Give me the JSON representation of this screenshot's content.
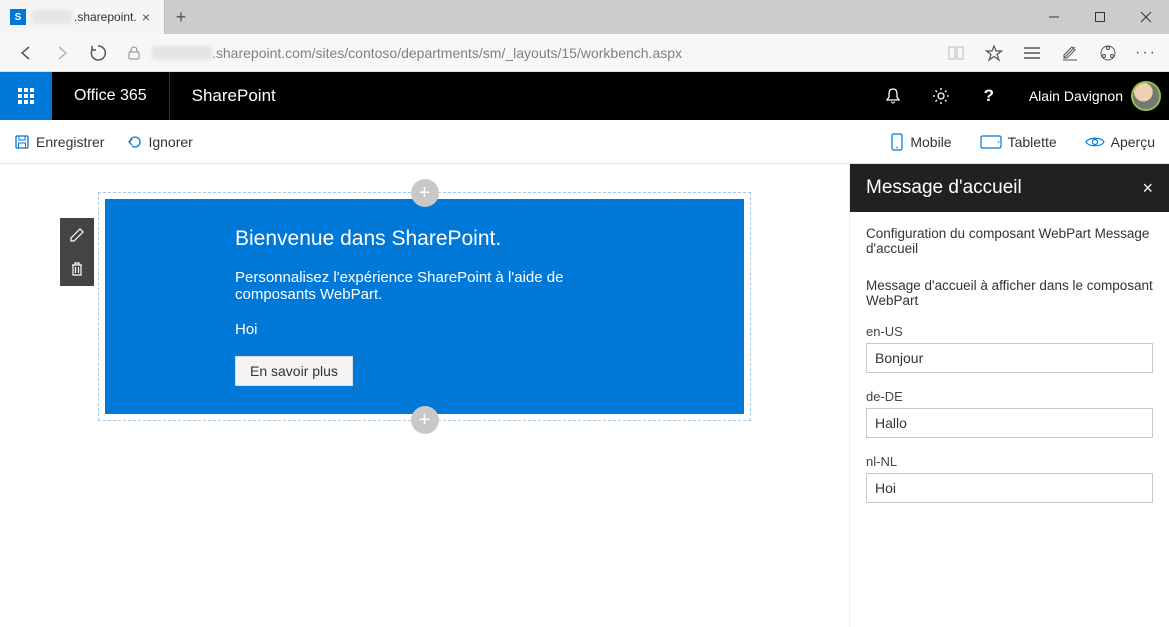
{
  "browser": {
    "tab_title": ".sharepoint.",
    "url_suffix": ".sharepoint.com/sites/contoso/departments/sm/_layouts/15/workbench.aspx"
  },
  "header": {
    "office": "Office 365",
    "app": "SharePoint",
    "user": "Alain Davignon"
  },
  "toolbar": {
    "save": "Enregistrer",
    "discard": "Ignorer",
    "mobile": "Mobile",
    "tablet": "Tablette",
    "preview": "Aperçu"
  },
  "webpart": {
    "title": "Bienvenue dans SharePoint.",
    "subtitle": "Personnalisez l'expérience SharePoint à l'aide de composants WebPart.",
    "greeting": "Hoi",
    "button": "En savoir plus"
  },
  "pane": {
    "title": "Message d'accueil",
    "description": "Configuration du composant WebPart Message d'accueil",
    "label": "Message d'accueil à afficher dans le composant WebPart",
    "fields": {
      "en_label": "en-US",
      "en_value": "Bonjour",
      "de_label": "de-DE",
      "de_value": "Hallo",
      "nl_label": "nl-NL",
      "nl_value": "Hoi"
    }
  }
}
